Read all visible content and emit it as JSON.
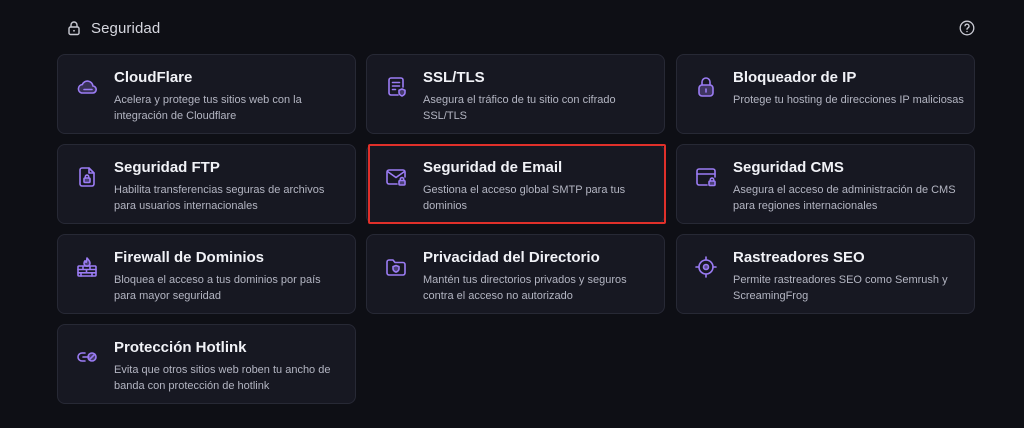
{
  "header": {
    "title": "Seguridad",
    "lock_icon": "lock-icon",
    "help_icon": "help-circle-icon"
  },
  "colors": {
    "accent": "#9b7cf4",
    "highlight": "#e0302a",
    "card_bg": "#171822",
    "page_bg": "#0e0f15"
  },
  "cards": [
    {
      "title": "CloudFlare",
      "desc": "Acelera y protege tus sitios web con la integración de Cloudflare",
      "icon": "cloud-icon"
    },
    {
      "title": "SSL/TLS",
      "desc": "Asegura el tráfico de tu sitio con cifrado SSL/TLS",
      "icon": "certificate-icon"
    },
    {
      "title": "Bloqueador de IP",
      "desc": "Protege tu hosting de direcciones IP maliciosas",
      "icon": "padlock-icon"
    },
    {
      "title": "Seguridad FTP",
      "desc": "Habilita transferencias seguras de archivos para usuarios internacionales",
      "icon": "file-lock-icon"
    },
    {
      "title": "Seguridad de Email",
      "desc": "Gestiona el acceso global SMTP para tus dominios",
      "icon": "mail-lock-icon"
    },
    {
      "title": "Seguridad CMS",
      "desc": "Asegura el acceso de administración de CMS para regiones internacionales",
      "icon": "browser-lock-icon"
    },
    {
      "title": "Firewall de Dominios",
      "desc": "Bloquea el acceso a tus dominios por país para mayor seguridad",
      "icon": "firewall-icon"
    },
    {
      "title": "Privacidad del Directorio",
      "desc": "Mantén tus directorios privados y seguros contra el acceso no autorizado",
      "icon": "folder-shield-icon"
    },
    {
      "title": "Rastreadores SEO",
      "desc": "Permite rastreadores SEO como Semrush y ScreamingFrog",
      "icon": "crosshair-icon"
    },
    {
      "title": "Protección Hotlink",
      "desc": "Evita que otros sitios web roben tu ancho de banda con protección de hotlink",
      "icon": "link-block-icon"
    }
  ]
}
